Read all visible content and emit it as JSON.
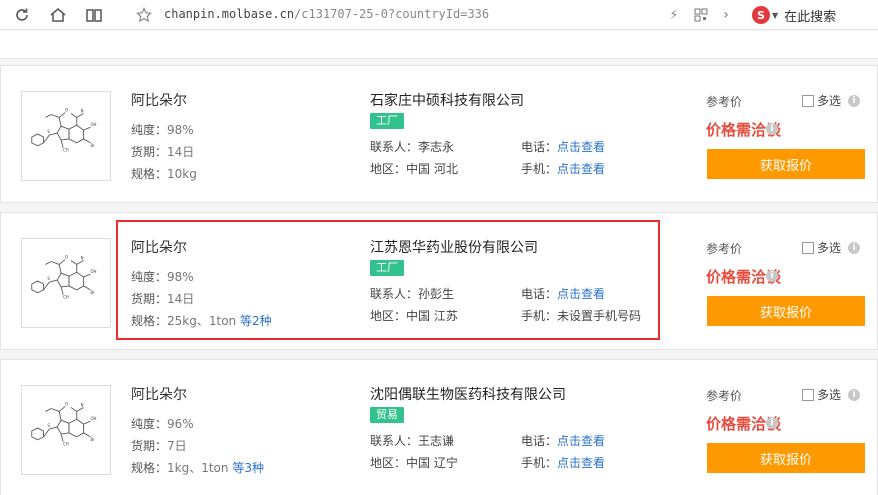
{
  "browser": {
    "url_host": "chanpin.molbase.cn",
    "url_path": "/c131707-25-0?countryId=336",
    "search_engine_letter": "S",
    "search_label": "在此搜索"
  },
  "listings": [
    {
      "product_name": "阿比朵尔",
      "purity_label": "纯度：",
      "purity": "98%",
      "lead_label": "货期：",
      "lead": "14日",
      "spec_label": "规格：",
      "spec": "10kg",
      "spec_more": "",
      "company": "石家庄中硕科技有限公司",
      "type_tag": "工厂",
      "type_color": "#33c18e",
      "contact_label": "联系人：",
      "contact": "李志永",
      "region_label": "地区：",
      "region": "中国 河北",
      "phone_label": "电话：",
      "phone": "点击查看",
      "mobile_label": "手机：",
      "mobile": "点击查看",
      "mobile_is_link": true,
      "ref_label": "参考价",
      "multi_label": "多选",
      "price_text": "价格需洽谈",
      "quote_button": "获取报价"
    },
    {
      "product_name": "阿比朵尔",
      "purity_label": "纯度：",
      "purity": "98%",
      "lead_label": "货期：",
      "lead": "14日",
      "spec_label": "规格：",
      "spec": "25kg、1ton",
      "spec_more": "等2种",
      "company": "江苏恩华药业股份有限公司",
      "type_tag": "工厂",
      "type_color": "#33c18e",
      "contact_label": "联系人：",
      "contact": "孙彭生",
      "region_label": "地区：",
      "region": "中国 江苏",
      "phone_label": "电话：",
      "phone": "点击查看",
      "mobile_label": "手机：",
      "mobile": "未设置手机号码",
      "mobile_is_link": false,
      "ref_label": "参考价",
      "multi_label": "多选",
      "price_text": "价格需洽谈",
      "quote_button": "获取报价"
    },
    {
      "product_name": "阿比朵尔",
      "purity_label": "纯度：",
      "purity": "96%",
      "lead_label": "货期：",
      "lead": "7日",
      "spec_label": "规格：",
      "spec": "1kg、1ton",
      "spec_more": "等3种",
      "company": "沈阳偶联生物医药科技有限公司",
      "type_tag": "贸易",
      "type_color": "#33c18e",
      "contact_label": "联系人：",
      "contact": "王志谦",
      "region_label": "地区：",
      "region": "中国 辽宁",
      "phone_label": "电话：",
      "phone": "点击查看",
      "mobile_label": "手机：",
      "mobile": "点击查看",
      "mobile_is_link": true,
      "ref_label": "参考价",
      "multi_label": "多选",
      "price_text": "价格需洽谈",
      "quote_button": "获取报价"
    }
  ],
  "colors": {
    "accent_orange": "#ff9900",
    "price_red": "#e84c3d",
    "link_blue": "#2a72c9",
    "highlight_red": "#e02d2d"
  }
}
